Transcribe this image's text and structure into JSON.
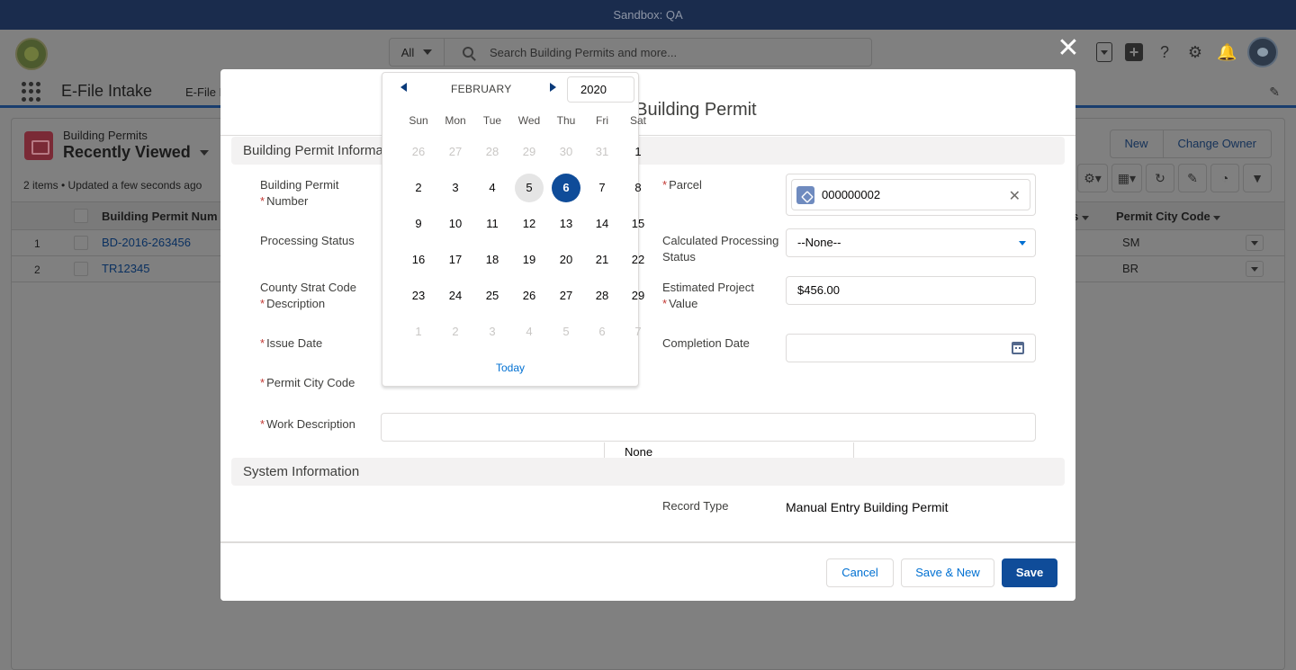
{
  "sandbox": {
    "label": "Sandbox: QA"
  },
  "header": {
    "search_scope": "All",
    "search_placeholder": "Search Building Permits and more..."
  },
  "nav": {
    "app_name": "E-File Intake",
    "item": "E-File I"
  },
  "list": {
    "object_label": "Building Permits",
    "view_name": "Recently Viewed",
    "meta": "2 items • Updated a few seconds ago",
    "buttons": {
      "new": "New",
      "change_owner": "Change Owner"
    },
    "columns": {
      "number": "Building Permit Num",
      "status_suffix": "us",
      "city_code": "Permit City Code"
    },
    "rows": [
      {
        "num": "1",
        "permit": "BD-2016-263456",
        "code": "SM"
      },
      {
        "num": "2",
        "permit": "TR12345",
        "code": "BR"
      }
    ]
  },
  "modal": {
    "title": "anual Entry Building Permit",
    "section_info": "Building Permit Informa",
    "section_system": "System Information",
    "fields": {
      "permit_number_label_1": "Building Permit",
      "permit_number_label_2": "Number",
      "processing_status_label": "Processing Status",
      "county_label_1": "County Strat Code",
      "county_label_2": "Description",
      "issue_date_label": "Issue Date",
      "permit_city_code_label": "Permit City Code",
      "permit_city_code_value": "None",
      "work_description_label": "Work Description",
      "parcel_label": "Parcel",
      "parcel_value": "000000002",
      "calc_status_label_1": "Calculated Processing",
      "calc_status_label_2": "Status",
      "calc_status_value": "--None--",
      "est_value_label_1": "Estimated Project",
      "est_value_label_2": "Value",
      "est_value_value": "$456.00",
      "completion_date_label": "Completion Date",
      "record_type_label": "Record Type",
      "record_type_value": "Manual Entry Building Permit"
    },
    "buttons": {
      "cancel": "Cancel",
      "save_new": "Save & New",
      "save": "Save"
    }
  },
  "datepicker": {
    "month": "FEBRUARY",
    "year": "2020",
    "weekdays": [
      "Sun",
      "Mon",
      "Tue",
      "Wed",
      "Thu",
      "Fri",
      "Sat"
    ],
    "weeks": [
      [
        "26",
        "27",
        "28",
        "29",
        "30",
        "31",
        "1"
      ],
      [
        "2",
        "3",
        "4",
        "5",
        "6",
        "7",
        "8"
      ],
      [
        "9",
        "10",
        "11",
        "12",
        "13",
        "14",
        "15"
      ],
      [
        "16",
        "17",
        "18",
        "19",
        "20",
        "21",
        "22"
      ],
      [
        "23",
        "24",
        "25",
        "26",
        "27",
        "28",
        "29"
      ],
      [
        "1",
        "2",
        "3",
        "4",
        "5",
        "6",
        "7"
      ]
    ],
    "today_day": "5",
    "selected_day": "6",
    "today_label": "Today"
  },
  "colors": {
    "brand": "#0f4c99",
    "link": "#0070d2",
    "required": "#c23934"
  },
  "icons": [
    "search-icon",
    "close-icon",
    "calendar-icon",
    "lookup-object-icon",
    "app-launcher-icon"
  ]
}
